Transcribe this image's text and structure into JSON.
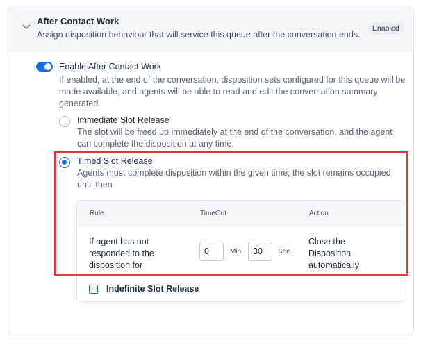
{
  "header": {
    "title": "After Contact Work",
    "description": "Assign disposition behaviour that will service this queue after the conversation ends.",
    "badge": "Enabled",
    "chevron_icon": "chevron-down-icon"
  },
  "enable_acw": {
    "checked": true,
    "title": "Enable After Contact Work",
    "description": "If enabled, at the end of the conversation, disposition sets configured for this queue will be made available, and agents will be able to read and edit the conversation summary generated."
  },
  "options": [
    {
      "title": "Immediate Slot Release",
      "description": "The slot will be freed up immediately at the end of the conversation, and the agent can complete the disposition at any time.",
      "selected": false
    },
    {
      "title": "Timed Slot Release",
      "description": "Agents must complete disposition within the given time; the slot remains occupied until then",
      "selected": true
    }
  ],
  "rule_table": {
    "headers": {
      "rule": "Rule",
      "timeout": "TimeOut",
      "action": "Action"
    },
    "row": {
      "rule": "If agent has not responded to the disposition for",
      "minutes": "0",
      "min_label": "Min",
      "seconds": "30",
      "sec_label": "Sec",
      "action": "Close the Disposition automatically"
    }
  },
  "indefinite": {
    "label": "Indefinite Slot Release",
    "checked": false
  },
  "colors": {
    "accent": "#1a6fdc",
    "highlight": "#e2363f"
  }
}
